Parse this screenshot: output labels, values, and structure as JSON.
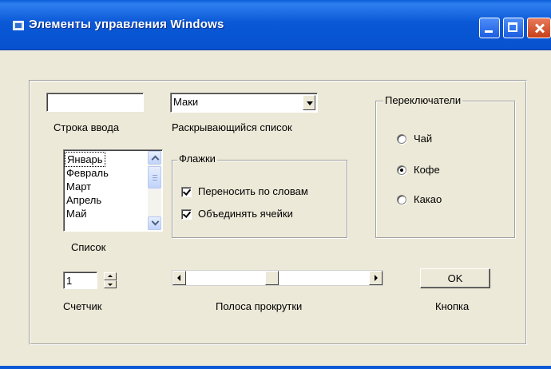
{
  "window": {
    "title": "Элементы управления Windows"
  },
  "textbox": {
    "value": "",
    "caption": "Строка ввода"
  },
  "combobox": {
    "selected": "Маки",
    "caption": "Раскрывающийся список"
  },
  "listbox": {
    "items": [
      "Январь",
      "Февраль",
      "Март",
      "Апрель",
      "Май"
    ],
    "selected_index": 0,
    "caption": "Список"
  },
  "checkboxes": {
    "title": "Флажки",
    "items": [
      {
        "label": "Переносить по словам",
        "checked": true
      },
      {
        "label": "Объединять ячейки",
        "checked": true
      }
    ]
  },
  "radios": {
    "title": "Переключатели",
    "items": [
      {
        "label": "Чай",
        "selected": false
      },
      {
        "label": "Кофе",
        "selected": true
      },
      {
        "label": "Какао",
        "selected": false
      }
    ]
  },
  "spinner": {
    "value": "1",
    "caption": "Счетчик"
  },
  "scrollbar": {
    "caption": "Полоса прокрутки",
    "position_fraction": 0.5
  },
  "button": {
    "label": "OK",
    "caption": "Кнопка"
  },
  "colors": {
    "titlebar": "#0a58d6",
    "face": "#ece9d8",
    "close": "#c6401a"
  }
}
